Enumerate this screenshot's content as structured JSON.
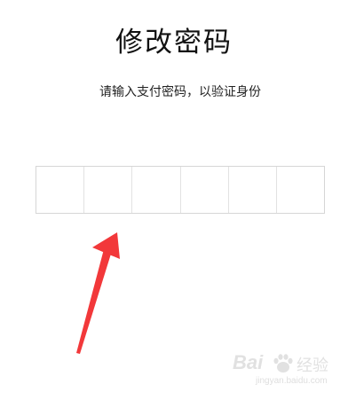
{
  "page": {
    "title": "修改密码",
    "subtitle": "请输入支付密码，以验证身份"
  },
  "pin_input": {
    "cells": [
      "",
      "",
      "",
      "",
      "",
      ""
    ],
    "digit_count": 6
  },
  "annotation": {
    "arrow_color": "#f2383a"
  },
  "watermark": {
    "logo_text": "Bai",
    "brand_text": "经验",
    "url": "jingyan.baidu.com"
  }
}
